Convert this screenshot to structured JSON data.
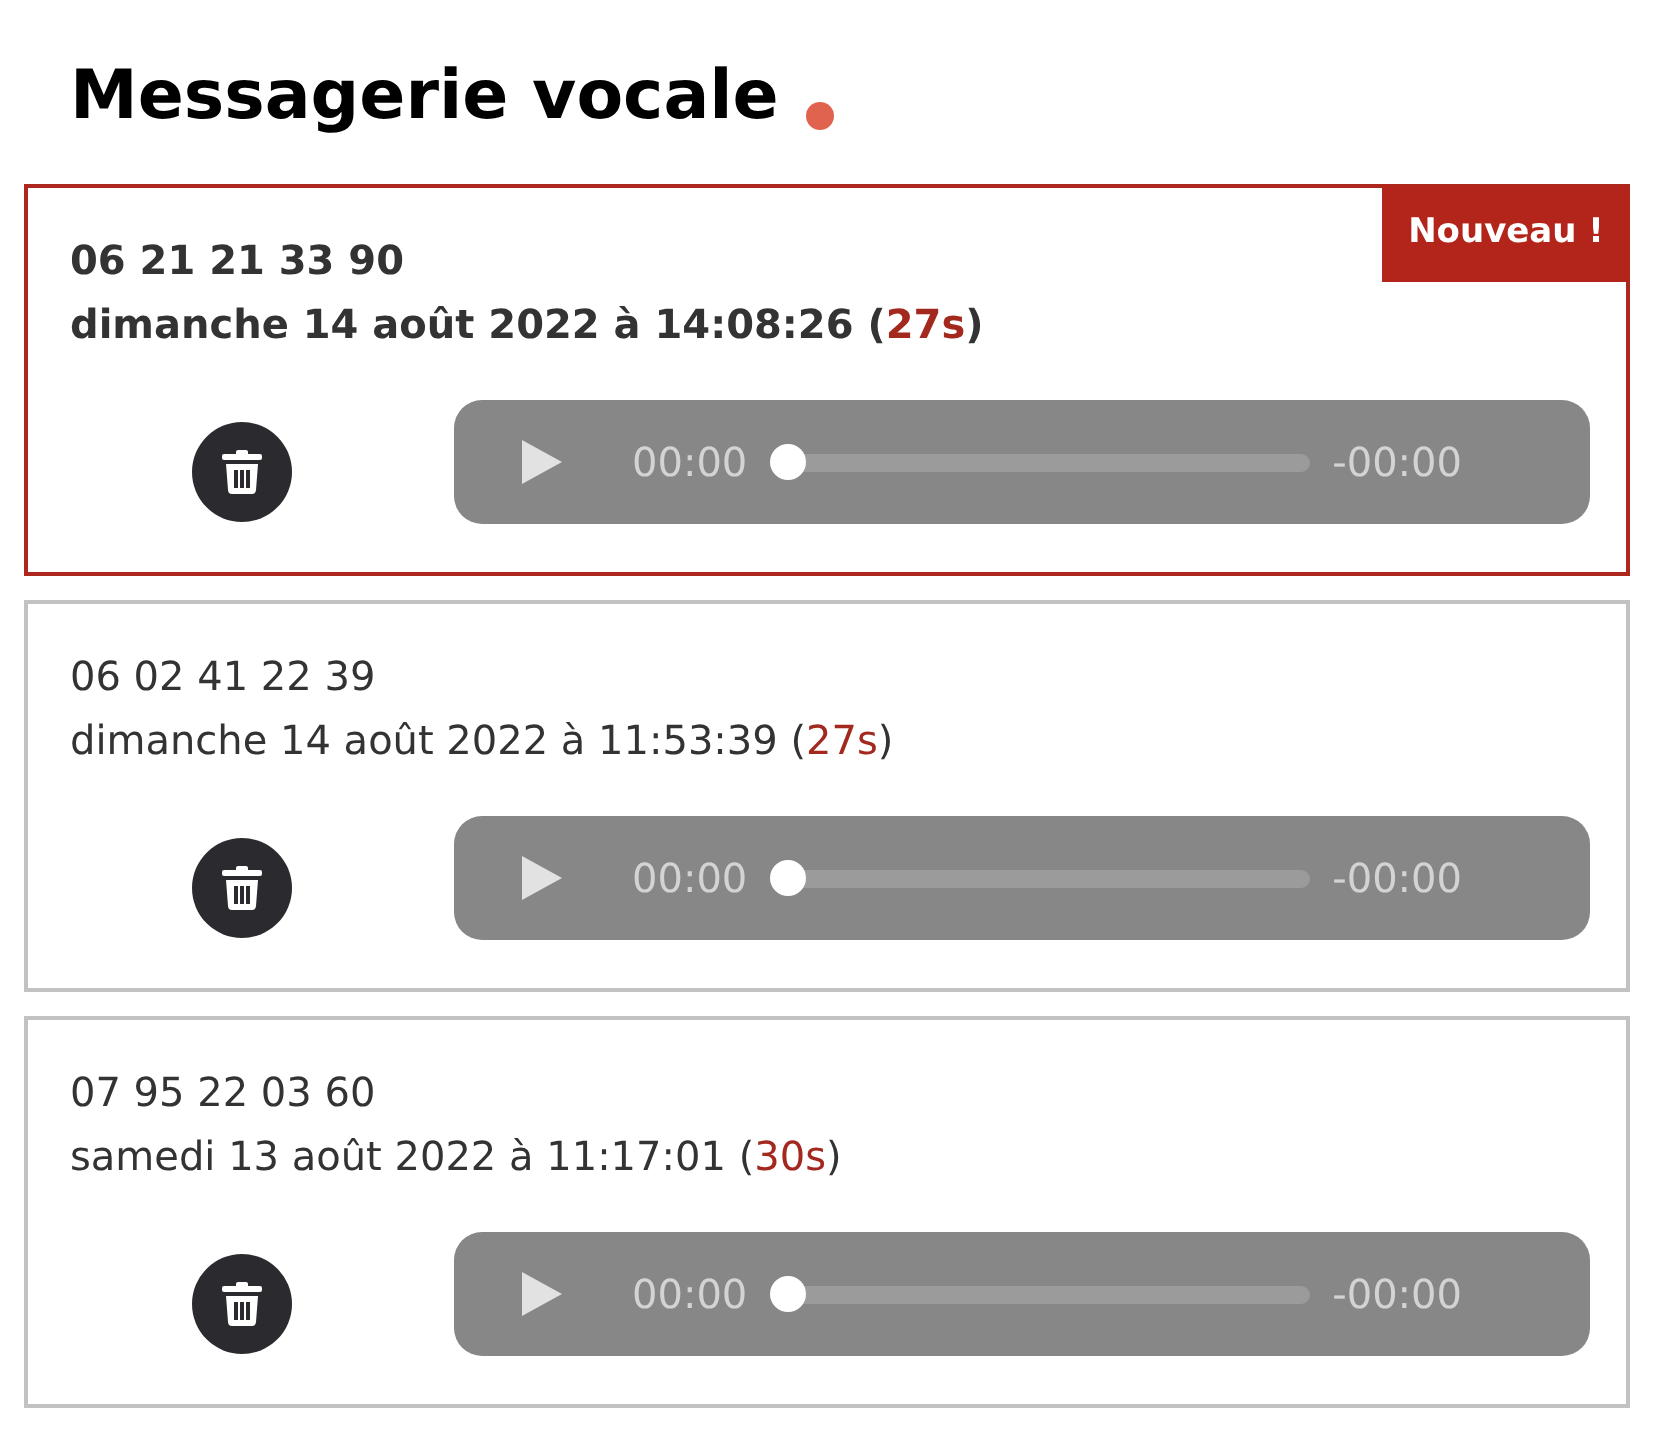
{
  "title": "Messagerie vocale",
  "unread_indicator": true,
  "messages": [
    {
      "number": "06 21 21 33 90",
      "date": "dimanche 14 août 2022 à 14:08:26",
      "duration": "(27s)",
      "new": true,
      "badge": "Nouveau !",
      "player": {
        "current": "00:00",
        "remaining": "-00:00",
        "level": 0
      }
    },
    {
      "number": "06 02 41 22 39",
      "date": "dimanche 14 août 2022 à 11:53:39",
      "duration": "(27s)",
      "new": false,
      "player": {
        "current": "00:00",
        "remaining": "-00:00",
        "level": 0
      }
    },
    {
      "number": "07 95 22 03 60",
      "date": "samedi 13 août 2022 à 11:17:01",
      "duration": "(30s)",
      "new": false,
      "player": {
        "current": "00:00",
        "remaining": "-00:00",
        "level": 0
      }
    }
  ]
}
